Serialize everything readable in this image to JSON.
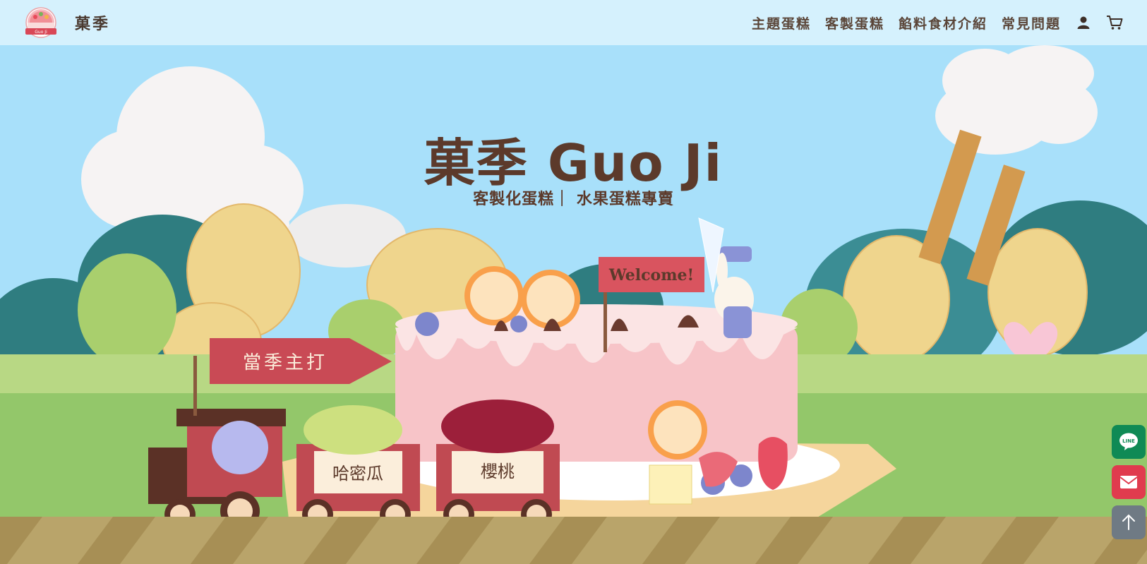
{
  "brand": {
    "name": "菓季",
    "logo_text": "Guo Ji",
    "logo_icon": "fruit-cake-logo"
  },
  "nav": {
    "items": [
      {
        "label": "主題蛋糕"
      },
      {
        "label": "客製蛋糕"
      },
      {
        "label": "餡料食材介紹"
      },
      {
        "label": "常見問題"
      }
    ],
    "user_icon": "user-icon",
    "cart_icon": "cart-icon"
  },
  "hero": {
    "title": "菓季 Guo Ji",
    "subtitle": "客製化蛋糕｜ 水果蛋糕專賣",
    "flag_label": "當季主打",
    "welcome_sign": "Welcome!",
    "cart_labels": [
      "哈密瓜",
      "櫻桃"
    ]
  },
  "floating": {
    "line_label": "LINE",
    "mail_icon": "mail-icon",
    "top_icon": "arrow-up-icon"
  },
  "colors": {
    "nav_bg": "#d5f1fd",
    "sky": "#a8e0fa",
    "title": "#5c3a2b",
    "line_green": "#0f8a55",
    "mail_red": "#e03b4e",
    "top_gray": "#6f7a84"
  }
}
